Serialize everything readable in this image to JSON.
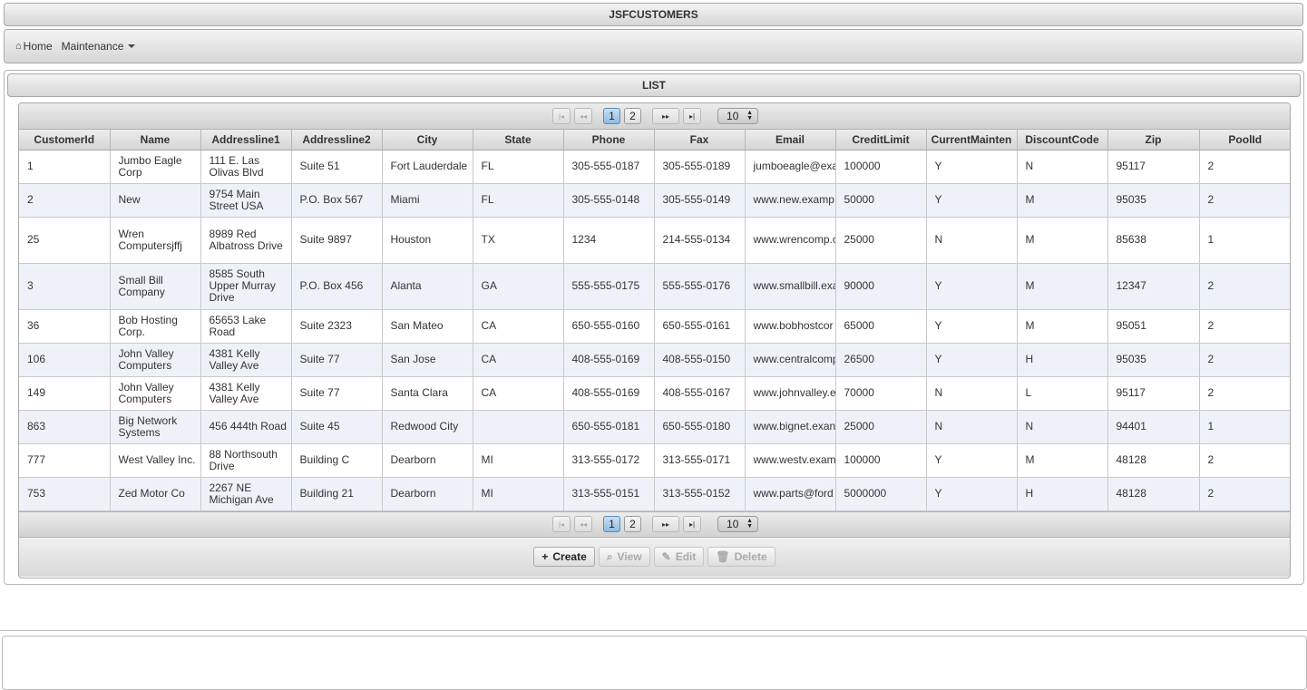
{
  "app": {
    "title": "JSFCUSTOMERS"
  },
  "menu": {
    "home": "Home",
    "maintenance": "Maintenance"
  },
  "panel": {
    "title": "LIST"
  },
  "paginator": {
    "first": "|◂",
    "prev": "◂◂",
    "pages": [
      "1",
      "2"
    ],
    "next": "▸▸",
    "last": "▸|",
    "rows_per_page": "10"
  },
  "table": {
    "columns": [
      "CustomerId",
      "Name",
      "Addressline1",
      "Addressline2",
      "City",
      "State",
      "Phone",
      "Fax",
      "Email",
      "CreditLimit",
      "CurrentMainten",
      "DiscountCode",
      "Zip",
      "PoolId"
    ],
    "rows": [
      [
        "1",
        "Jumbo Eagle Corp",
        "111 E. Las Olivas Blvd",
        "Suite 51",
        "Fort Lauderdale",
        "FL",
        "305-555-0187",
        "305-555-0189",
        "jumboeagle@exa",
        "100000",
        "Y",
        "N",
        "95117",
        "2"
      ],
      [
        "2",
        "New",
        "9754 Main Street USA",
        "P.O. Box 567",
        "Miami",
        "FL",
        "305-555-0148",
        "305-555-0149",
        "www.new.examp",
        "50000",
        "Y",
        "M",
        "95035",
        "2"
      ],
      [
        "25",
        "Wren Computersjffj",
        "8989 Red Albatross Drive",
        "Suite 9897",
        "Houston",
        "TX",
        "1234",
        "214-555-0134",
        "www.wrencomp.c",
        "25000",
        "N",
        "M",
        "85638",
        "1"
      ],
      [
        "3",
        "Small Bill Company",
        "8585 South Upper Murray Drive",
        "P.O. Box 456",
        "Alanta",
        "GA",
        "555-555-0175",
        "555-555-0176",
        "www.smallbill.exa",
        "90000",
        "Y",
        "M",
        "12347",
        "2"
      ],
      [
        "36",
        "Bob Hosting Corp.",
        "65653 Lake Road",
        "Suite 2323",
        "San Mateo",
        "CA",
        "650-555-0160",
        "650-555-0161",
        "www.bobhostcor",
        "65000",
        "Y",
        "M",
        "95051",
        "2"
      ],
      [
        "106",
        "John Valley Computers",
        "4381 Kelly Valley Ave",
        "Suite 77",
        "San Jose",
        "CA",
        "408-555-0169",
        "408-555-0150",
        "www.centralcomp",
        "26500",
        "Y",
        "H",
        "95035",
        "2"
      ],
      [
        "149",
        "John Valley Computers",
        "4381 Kelly Valley Ave",
        "Suite 77",
        "Santa Clara",
        "CA",
        "408-555-0169",
        "408-555-0167",
        "www.johnvalley.e",
        "70000",
        "N",
        "L",
        "95117",
        "2"
      ],
      [
        "863",
        "Big Network Systems",
        "456 444th Road",
        "Suite 45",
        "Redwood City",
        "",
        "650-555-0181",
        "650-555-0180",
        "www.bignet.exan",
        "25000",
        "N",
        "N",
        "94401",
        "1"
      ],
      [
        "777",
        "West Valley Inc.",
        "88 Northsouth Drive",
        "Building C",
        "Dearborn",
        "MI",
        "313-555-0172",
        "313-555-0171",
        "www.westv.exam",
        "100000",
        "Y",
        "M",
        "48128",
        "2"
      ],
      [
        "753",
        "Zed Motor Co",
        "2267 NE Michigan Ave",
        "Building 21",
        "Dearborn",
        "MI",
        "313-555-0151",
        "313-555-0152",
        "www.parts@ford",
        "5000000",
        "Y",
        "H",
        "48128",
        "2"
      ]
    ]
  },
  "actions": {
    "create": "Create",
    "view": "View",
    "edit": "Edit",
    "delete": "Delete"
  }
}
